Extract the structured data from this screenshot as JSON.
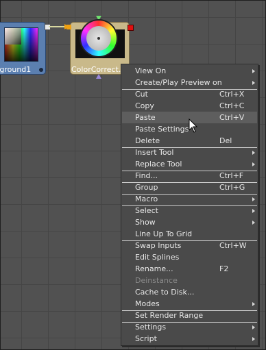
{
  "nodes": {
    "background_label": "kground1",
    "colorcorrect_label": "ColorCorrect..."
  },
  "menu": {
    "items": [
      {
        "label": "View On",
        "shortcut": "",
        "submenu": true,
        "disabled": false
      },
      {
        "label": "Create/Play Preview on",
        "shortcut": "",
        "submenu": true,
        "disabled": false
      },
      {
        "label": "Cut",
        "shortcut": "Ctrl+X",
        "submenu": false,
        "disabled": false
      },
      {
        "label": "Copy",
        "shortcut": "Ctrl+C",
        "submenu": false,
        "disabled": false
      },
      {
        "label": "Paste",
        "shortcut": "Ctrl+V",
        "submenu": false,
        "disabled": false,
        "highlighted": true
      },
      {
        "label": "Paste Settings",
        "shortcut": "",
        "submenu": false,
        "disabled": false
      },
      {
        "label": "Delete",
        "shortcut": "Del",
        "submenu": false,
        "disabled": false
      },
      {
        "label": "Insert Tool",
        "shortcut": "",
        "submenu": true,
        "disabled": false
      },
      {
        "label": "Replace Tool",
        "shortcut": "",
        "submenu": true,
        "disabled": false
      },
      {
        "label": "Find...",
        "shortcut": "Ctrl+F",
        "submenu": false,
        "disabled": false
      },
      {
        "label": "Group",
        "shortcut": "Ctrl+G",
        "submenu": false,
        "disabled": false
      },
      {
        "label": "Macro",
        "shortcut": "",
        "submenu": true,
        "disabled": false
      },
      {
        "label": "Select",
        "shortcut": "",
        "submenu": true,
        "disabled": false
      },
      {
        "label": "Show",
        "shortcut": "",
        "submenu": true,
        "disabled": false
      },
      {
        "label": "Line Up To Grid",
        "shortcut": "",
        "submenu": false,
        "disabled": false
      },
      {
        "label": "Swap Inputs",
        "shortcut": "Ctrl+W",
        "submenu": false,
        "disabled": false
      },
      {
        "label": "Edit Splines",
        "shortcut": "",
        "submenu": false,
        "disabled": false
      },
      {
        "label": "Rename...",
        "shortcut": "F2",
        "submenu": false,
        "disabled": false
      },
      {
        "label": "Deinstance",
        "shortcut": "",
        "submenu": false,
        "disabled": true
      },
      {
        "label": "Cache to Disk...",
        "shortcut": "",
        "submenu": false,
        "disabled": false
      },
      {
        "label": "Modes",
        "shortcut": "",
        "submenu": true,
        "disabled": false
      },
      {
        "label": "Set Render Range",
        "shortcut": "",
        "submenu": false,
        "disabled": false
      },
      {
        "label": "Settings",
        "shortcut": "",
        "submenu": true,
        "disabled": false
      },
      {
        "label": "Script",
        "shortcut": "",
        "submenu": true,
        "disabled": false
      }
    ]
  }
}
